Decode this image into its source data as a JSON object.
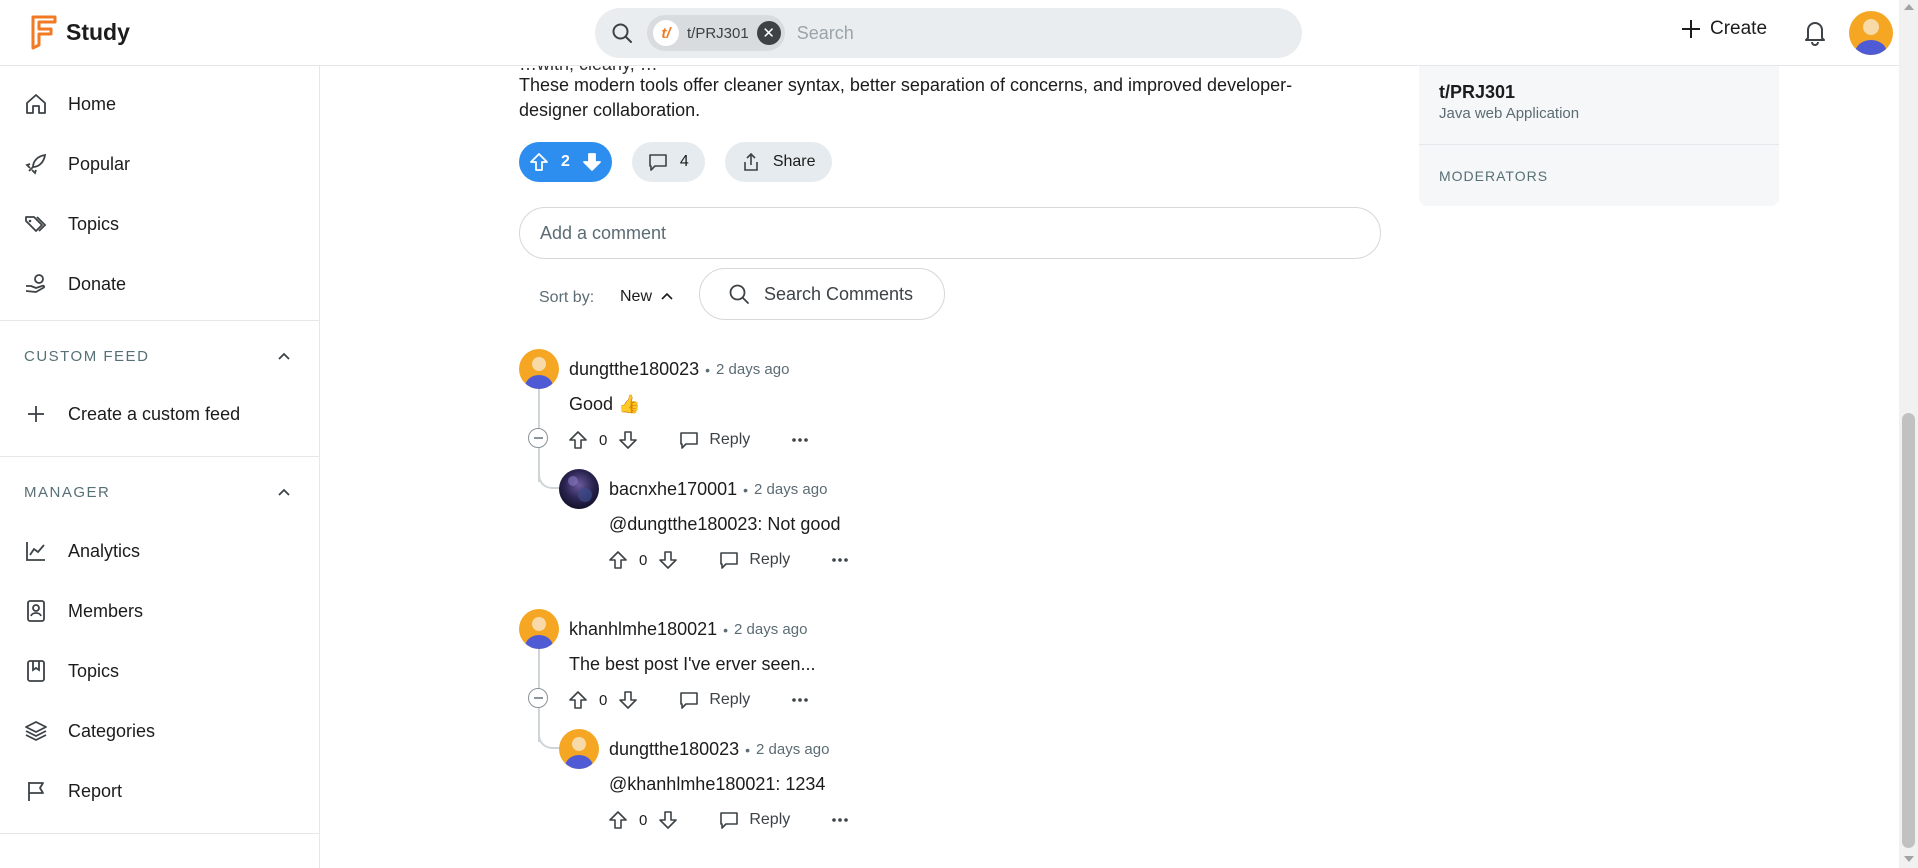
{
  "app": {
    "name": "Study"
  },
  "header": {
    "search_chip": "t/PRJ301",
    "chip_logo": "t/",
    "search_placeholder": "Search",
    "create_label": "Create"
  },
  "sidebar": {
    "main_items": [
      {
        "label": "Home",
        "icon": "home-icon"
      },
      {
        "label": "Popular",
        "icon": "rocket-icon"
      },
      {
        "label": "Topics",
        "icon": "tags-icon"
      },
      {
        "label": "Donate",
        "icon": "donate-hand-icon"
      }
    ],
    "custom_feed": {
      "title": "CUSTOM FEED",
      "create_label": "Create a custom feed"
    },
    "manager": {
      "title": "MANAGER",
      "items": [
        {
          "label": "Analytics",
          "icon": "analytics-chart-icon"
        },
        {
          "label": "Members",
          "icon": "members-icon"
        },
        {
          "label": "Topics",
          "icon": "bookmark-icon"
        },
        {
          "label": "Categories",
          "icon": "layers-icon"
        },
        {
          "label": "Report",
          "icon": "flag-icon"
        }
      ]
    }
  },
  "post": {
    "text_line_clipped": "…with, clearly, …",
    "text_line_1": "These modern tools offer cleaner syntax, better separation of concerns, and improved developer-",
    "text_line_2": "designer collaboration.",
    "vote_count": "2",
    "comment_count": "4",
    "share_label": "Share"
  },
  "comment_form": {
    "placeholder": "Add a comment",
    "sort_label": "Sort by:",
    "sort_value": "New",
    "search_label": "Search Comments"
  },
  "comments": [
    {
      "user": "dungtthe180023",
      "time": "2 days ago",
      "body": "Good 👍",
      "votes": "0",
      "reply_label": "Reply",
      "replies": [
        {
          "user": "bacnxhe170001",
          "time": "2 days ago",
          "body": "@dungtthe180023: Not good",
          "votes": "0",
          "reply_label": "Reply"
        }
      ]
    },
    {
      "user": "khanhlmhe180021",
      "time": "2 days ago",
      "body": "The best post I've erver seen...",
      "votes": "0",
      "reply_label": "Reply",
      "replies": [
        {
          "user": "dungtthe180023",
          "time": "2 days ago",
          "body": "@khanhlmhe180021: 1234",
          "votes": "0",
          "reply_label": "Reply"
        }
      ]
    }
  ],
  "right_panel": {
    "community_name": "t/PRJ301",
    "community_desc": "Java web Application",
    "moderators_title": "MODERATORS"
  },
  "colors": {
    "brand": "#f27a24",
    "upvote_active": "#2d8ef0",
    "avatar_bg": "#f5a623",
    "avatar_body": "#4f5bd5"
  }
}
